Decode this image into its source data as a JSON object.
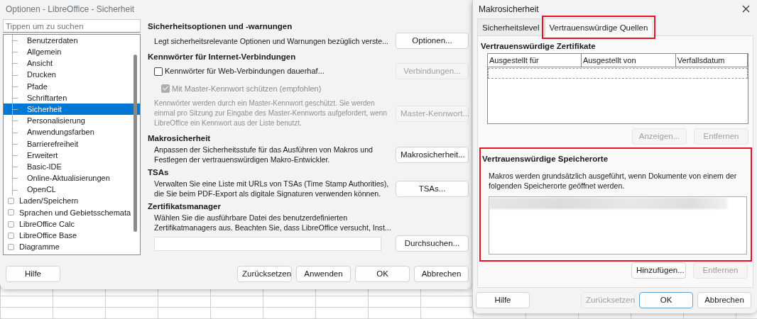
{
  "options_dialog": {
    "title": "Optionen - LibreOffice - Sicherheit",
    "search": {
      "placeholder": "Tippen um zu suchen"
    },
    "tree": [
      {
        "children": [
          {
            "label": "Benutzerdaten",
            "selected": false
          },
          {
            "label": "Allgemein",
            "selected": false
          },
          {
            "label": "Ansicht",
            "selected": false
          },
          {
            "label": "Drucken",
            "selected": false
          },
          {
            "label": "Pfade",
            "selected": false
          },
          {
            "label": "Schriftarten",
            "selected": false
          },
          {
            "label": "Sicherheit",
            "selected": true
          },
          {
            "label": "Personalisierung",
            "selected": false
          },
          {
            "label": "Anwendungsfarben",
            "selected": false
          },
          {
            "label": "Barrierefreiheit",
            "selected": false
          },
          {
            "label": "Erweitert",
            "selected": false
          },
          {
            "label": "Basic-IDE",
            "selected": false
          },
          {
            "label": "Online-Aktualisierungen",
            "selected": false
          },
          {
            "label": "OpenCL",
            "selected": false
          }
        ]
      },
      {
        "label": "Laden/Speichern",
        "selected": false,
        "expanded": false
      },
      {
        "label": "Sprachen und Gebietsschemata",
        "selected": false,
        "expanded": false
      },
      {
        "label": "LibreOffice Calc",
        "selected": false,
        "expanded": false
      },
      {
        "label": "LibreOffice Base",
        "selected": false,
        "expanded": false
      },
      {
        "label": "Diagramme",
        "selected": false,
        "expanded": false
      }
    ],
    "sections": [
      {
        "heading": "Sicherheitsoptionen und -warnungen",
        "items": [
          {
            "kind": "description",
            "text": "Legt sicherheitsrelevante Optionen und Warnungen bezüglich verste...",
            "button": {
              "label": "Optionen...",
              "disabled": false
            }
          }
        ]
      },
      {
        "heading": "Kennwörter für Internet-Verbindungen",
        "items": [
          {
            "kind": "checkbox",
            "label": "Kennwörter für Web-Verbindungen dauerhaf...",
            "checked": false,
            "disabled": false,
            "button": {
              "label": "Verbindungen...",
              "disabled": true
            }
          },
          {
            "kind": "subcheckbox",
            "label": "Mit Master-Kennwort schützen (empfohlen)",
            "checked": true,
            "disabled": true
          },
          {
            "kind": "note",
            "text": "Kennwörter werden durch ein Master-Kennwort geschützt. Sie werden einmal pro Sitzung zur Eingabe des Master-Kennworts aufgefordert, wenn LibreOffice ein Kennwort aus der Liste benutzt.",
            "button": {
              "label": "Master-Kennwort...",
              "disabled": true
            }
          }
        ]
      },
      {
        "heading": "Makrosicherheit",
        "items": [
          {
            "kind": "description",
            "text": "Anpassen der Sicherheitsstufe für das Ausführen von Makros und Festlegen der vertrauenswürdigen Makro-Entwickler.",
            "button": {
              "label": "Makrosicherheit...",
              "disabled": false
            }
          }
        ]
      },
      {
        "heading": "TSAs",
        "items": [
          {
            "kind": "description",
            "text": "Verwalten Sie eine Liste mit URLs von TSAs (Time Stamp Authorities), die Sie beim PDF-Export als digitale Signaturen verwenden können.",
            "button": {
              "label": "TSAs...",
              "disabled": false
            }
          }
        ]
      },
      {
        "heading": "Zertifikatsmanager",
        "items": [
          {
            "kind": "description",
            "text": "Wählen Sie die ausführbare Datei des benutzerdefinierten Zertifikatmanagers aus. Beachten Sie, dass LibreOffice versucht, Inst..."
          },
          {
            "kind": "field",
            "button": {
              "label": "Durchsuchen...",
              "disabled": false
            }
          }
        ]
      }
    ],
    "help_button": "Hilfe",
    "buttons": [
      {
        "label": "Zurücksetzen",
        "disabled": false,
        "default": false
      },
      {
        "label": "Anwenden",
        "disabled": false,
        "default": false
      },
      {
        "label": "OK",
        "disabled": false,
        "default": false
      },
      {
        "label": "Abbrechen",
        "disabled": false,
        "default": false
      }
    ]
  },
  "macro_dialog": {
    "title": "Makrosicherheit",
    "tabs": [
      {
        "label": "Sicherheitslevel",
        "selected": false,
        "highlighted": false
      },
      {
        "label": "Vertrauenswürdige Quellen",
        "selected": true,
        "highlighted": true
      }
    ],
    "certificates": {
      "heading": "Vertrauenswürdige Zertifikate",
      "columns": [
        "Ausgestellt für",
        "Ausgestellt von",
        "Verfallsdatum"
      ],
      "buttons": [
        {
          "label": "Anzeigen...",
          "disabled": true
        },
        {
          "label": "Entfernen",
          "disabled": true
        }
      ]
    },
    "locations": {
      "heading": "Vertrauenswürdige Speicherorte",
      "highlighted": true,
      "text": "Makros werden grundsätzlich ausgeführt, wenn Dokumente von einem der folgenden Speicherorte geöffnet werden.",
      "entries": [
        {
          "kind": "blurred"
        }
      ],
      "buttons": [
        {
          "label": "Hinzufügen...",
          "disabled": false
        },
        {
          "label": "Entfernen",
          "disabled": true
        }
      ]
    },
    "help_button": "Hilfe",
    "buttons": [
      {
        "label": "Zurücksetzen",
        "disabled": true,
        "default": false
      },
      {
        "label": "OK",
        "disabled": false,
        "default": true
      },
      {
        "label": "Abbrechen",
        "disabled": false,
        "default": false
      }
    ]
  }
}
